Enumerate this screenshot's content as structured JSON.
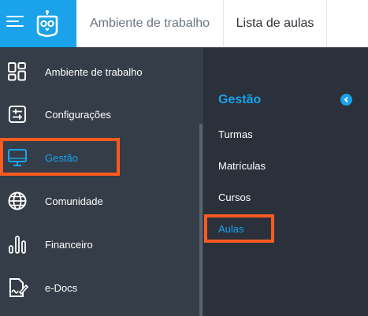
{
  "header": {
    "tabs": [
      {
        "label": "Ambiente de trabalho"
      },
      {
        "label": "Lista de aulas"
      }
    ]
  },
  "sidebar": {
    "items": [
      {
        "label": "Ambiente de trabalho",
        "icon": "dashboard-grid-icon"
      },
      {
        "label": "Configurações",
        "icon": "sliders-icon"
      },
      {
        "label": "Gestão",
        "icon": "monitor-icon",
        "active": true
      },
      {
        "label": "Comunidade",
        "icon": "globe-icon"
      },
      {
        "label": "Financeiro",
        "icon": "bar-chart-icon"
      },
      {
        "label": "e-Docs",
        "icon": "document-signature-icon"
      }
    ]
  },
  "submenu": {
    "title": "Gestão",
    "items": [
      {
        "label": "Turmas"
      },
      {
        "label": "Matrículas"
      },
      {
        "label": "Cursos"
      },
      {
        "label": "Aulas",
        "active": true
      }
    ]
  },
  "colors": {
    "brand": "#1aa3ea",
    "highlight": "#ff5a1f",
    "sidebar_bg": "#353d48",
    "submenu_bg": "#2a313b"
  }
}
